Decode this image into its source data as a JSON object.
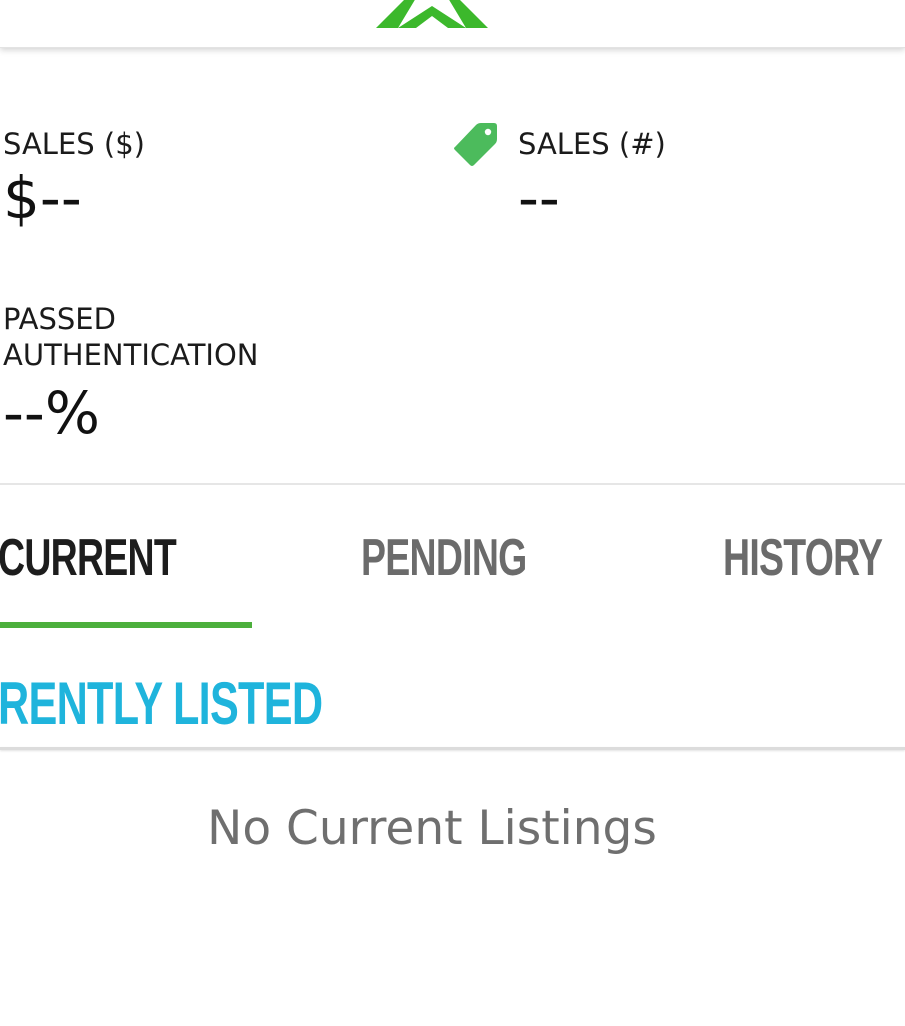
{
  "header": {
    "logo_icon": "brand-logo-icon",
    "logo_color": "#3cb82c"
  },
  "stats": {
    "sales_dollar": {
      "label": "SALES ($)",
      "value": "$--"
    },
    "sales_count": {
      "label": "SALES (#)",
      "value": "--",
      "icon": "tag-icon",
      "icon_color": "#4cbb5c"
    },
    "passed_authentication": {
      "label_line1": "PASSED",
      "label_line2": "AUTHENTICATION",
      "value": "--%"
    }
  },
  "tabs": [
    {
      "label": "CURRENT",
      "selected": true
    },
    {
      "label": "PENDING",
      "selected": false
    },
    {
      "label": "HISTORY",
      "selected": false
    }
  ],
  "tab_indicator_color": "#4caf3c",
  "section": {
    "title": "RENTLY LISTED",
    "title_color": "#1fb4dc",
    "empty_message": "No Current Listings"
  }
}
